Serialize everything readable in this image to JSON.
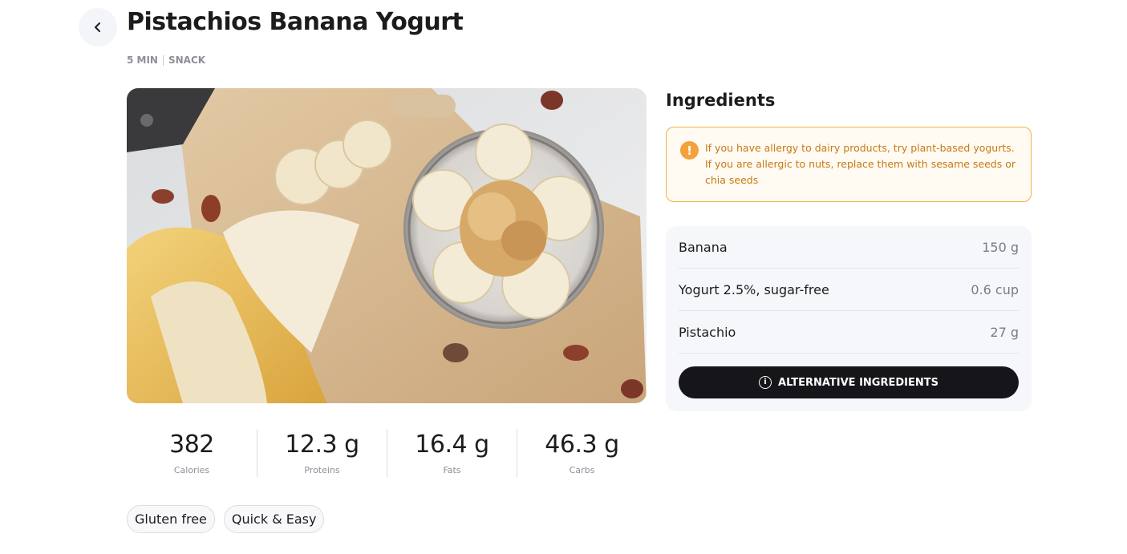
{
  "header": {
    "back_icon": "chevron-left-icon",
    "title": "Pistachios Banana Yogurt",
    "time": "5 MIN",
    "category": "SNACK"
  },
  "nutrition": [
    {
      "value": "382",
      "label": "Calories"
    },
    {
      "value": "12.3 g",
      "label": "Proteins"
    },
    {
      "value": "16.4 g",
      "label": "Fats"
    },
    {
      "value": "46.3 g",
      "label": "Carbs"
    }
  ],
  "tags": [
    "Gluten free",
    "Quick & Easy"
  ],
  "ingredients": {
    "title": "Ingredients",
    "alert_icon": "exclamation-icon",
    "alert_text": "If you have allergy to dairy products, try plant-based yogurts. If you are allergic to nuts, replace them with sesame seeds or chia seeds",
    "items": [
      {
        "name": "Banana",
        "qty": "150 g"
      },
      {
        "name": "Yogurt 2.5%, sugar-free",
        "qty": "0.6 cup"
      },
      {
        "name": "Pistachio",
        "qty": "27 g"
      }
    ],
    "alt_button_label": "ALTERNATIVE INGREDIENTS",
    "alt_button_icon": "info-icon"
  },
  "colors": {
    "accent_dark": "#15151a",
    "alert_border": "#f0b24a",
    "alert_text": "#c77912",
    "muted": "#8e8e99"
  }
}
